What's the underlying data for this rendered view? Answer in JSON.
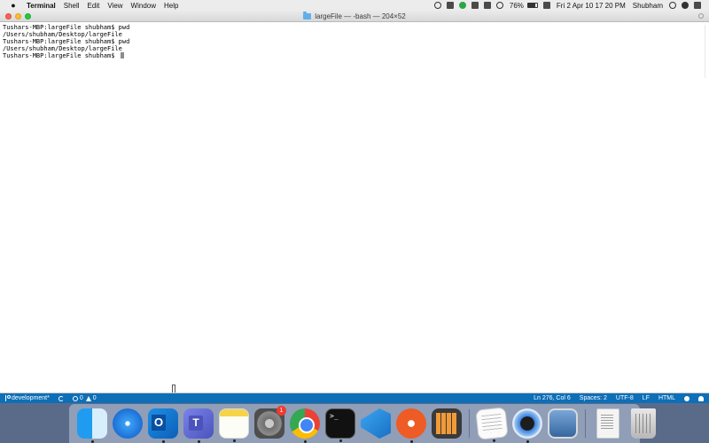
{
  "menubar": {
    "apple_label": "",
    "app_name": "Terminal",
    "menus": [
      "Shell",
      "Edit",
      "View",
      "Window",
      "Help"
    ],
    "battery_percent": "76%",
    "battery_level": 0.76,
    "datetime": "Fri 2 Apr  10 17 20 PM",
    "user": "Shubham"
  },
  "window": {
    "title": "largeFile — -bash — 204×52",
    "terminal_lines": [
      "Tushars-MBP:largeFile shubham$ pwd",
      "/Users/shubham/Desktop/largeFile",
      "Tushars-MBP:largeFile shubham$ pwd",
      "/Users/shubham/Desktop/largeFile",
      "Tushars-MBP:largeFile shubham$ "
    ]
  },
  "statusbar": {
    "branch": "development*",
    "errors": "0",
    "warnings": "0",
    "position": "Ln 276, Col 6",
    "spaces": "Spaces: 2",
    "encoding": "UTF-8",
    "eol": "LF",
    "language": "HTML"
  },
  "dock": {
    "apps": [
      {
        "icon": "finder-icon",
        "running": true
      },
      {
        "icon": "safari-icon",
        "running": false
      },
      {
        "icon": "outlook-icon",
        "running": true
      },
      {
        "icon": "teams-icon",
        "running": true
      },
      {
        "icon": "notes-icon",
        "running": true
      },
      {
        "icon": "system-preferences-icon",
        "running": false,
        "badge": "1"
      },
      {
        "icon": "chrome-icon",
        "running": true
      },
      {
        "icon": "terminal-icon",
        "running": true
      },
      {
        "icon": "vscode-icon",
        "running": true
      },
      {
        "icon": "postman-icon",
        "running": true
      },
      {
        "icon": "calculator-icon",
        "running": false
      }
    ],
    "recent": [
      {
        "icon": "textedit-icon",
        "running": true
      },
      {
        "icon": "quicktime-icon",
        "running": true
      },
      {
        "icon": "preview-icon",
        "running": false
      }
    ],
    "extras": [
      {
        "icon": "document-icon"
      },
      {
        "icon": "trash-icon"
      }
    ]
  }
}
